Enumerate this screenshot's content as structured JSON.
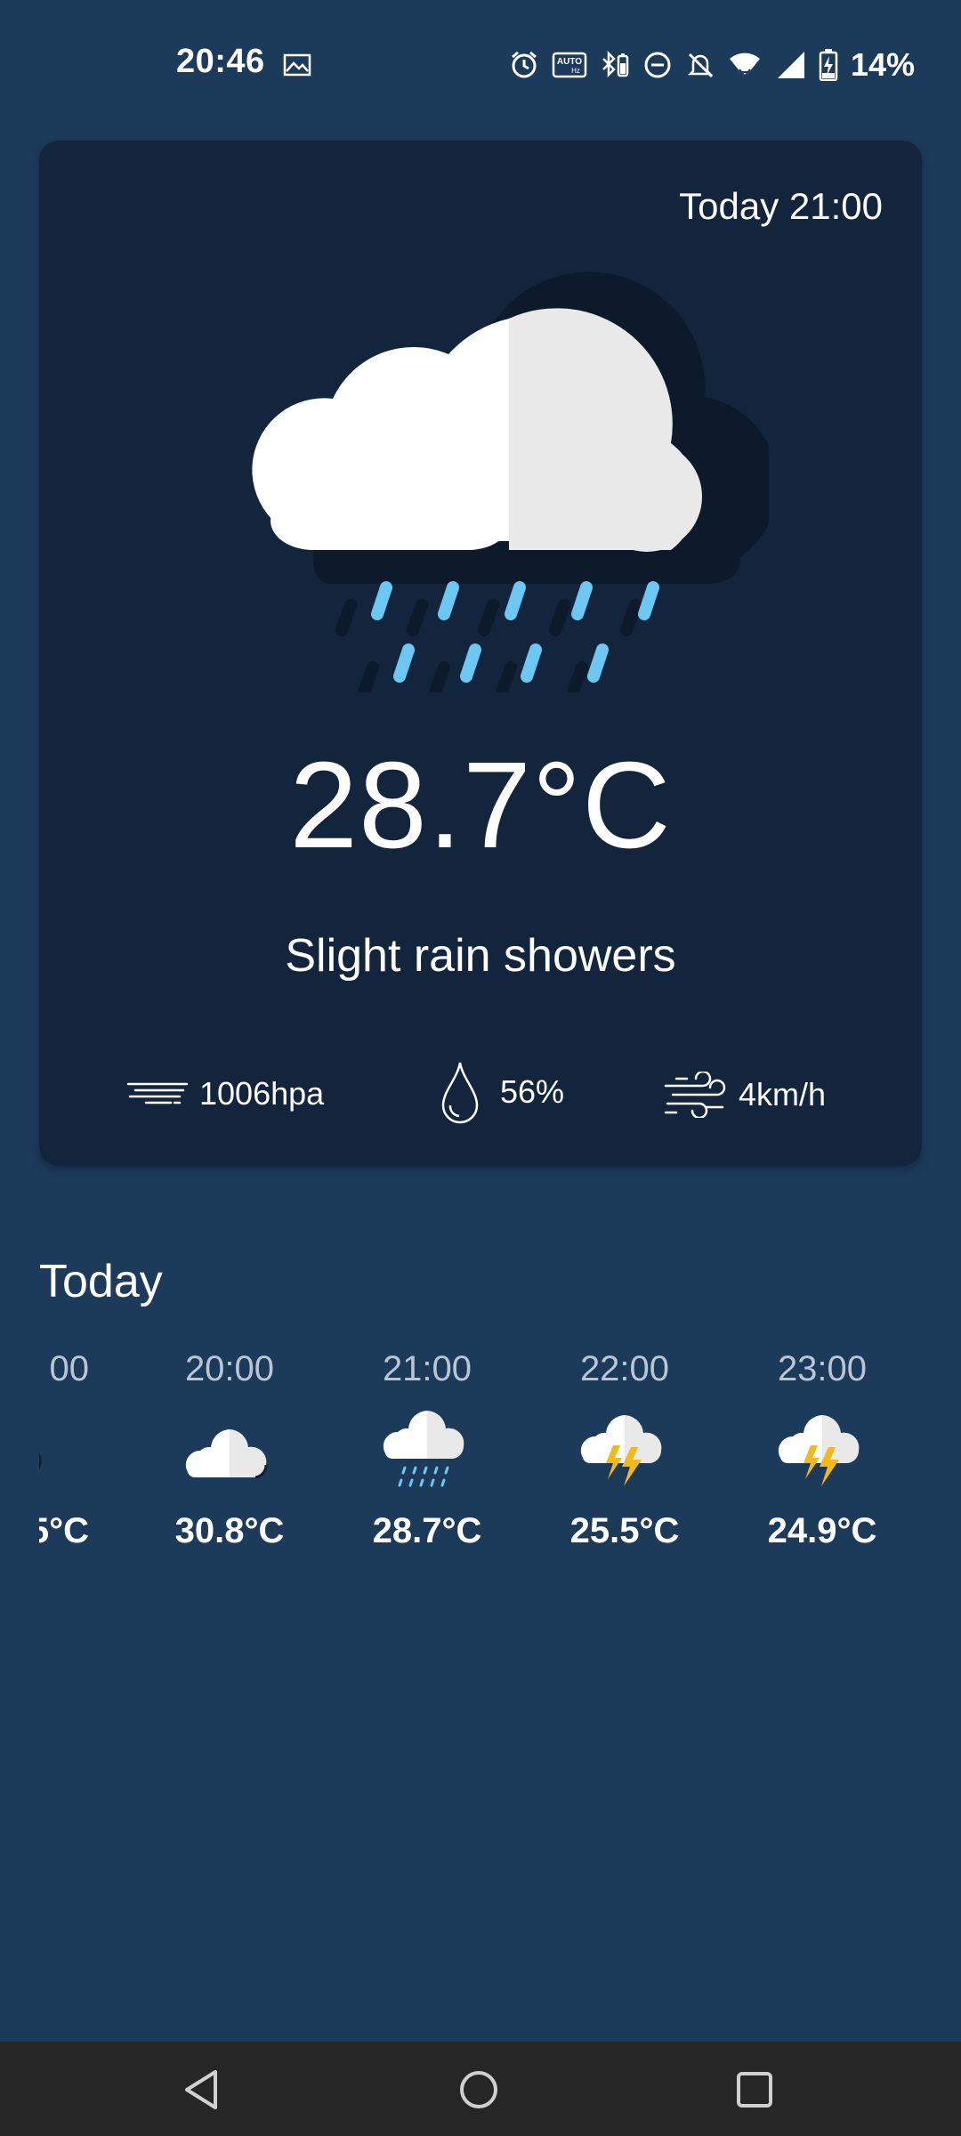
{
  "status_bar": {
    "time": "20:46",
    "battery": "14%",
    "icons": [
      "image-icon",
      "alarm-icon",
      "auto-hz-icon",
      "bluetooth-battery-icon",
      "do-not-disturb-icon",
      "bell-off-icon",
      "wifi-icon",
      "signal-icon",
      "battery-charging-icon"
    ]
  },
  "current": {
    "datetime": "Today 21:00",
    "temperature": "28.7°C",
    "description": "Slight rain showers",
    "icon": "cloud-rain-icon",
    "pressure": "1006hpa",
    "humidity": "56%",
    "wind": "4km/h"
  },
  "today": {
    "title": "Today",
    "hours": [
      {
        "time": "00",
        "temp": "5°C",
        "icon": "cloud-icon"
      },
      {
        "time": "20:00",
        "temp": "30.8°C",
        "icon": "cloud-icon"
      },
      {
        "time": "21:00",
        "temp": "28.7°C",
        "icon": "cloud-rain-icon"
      },
      {
        "time": "22:00",
        "temp": "25.5°C",
        "icon": "cloud-lightning-icon"
      },
      {
        "time": "23:00",
        "temp": "24.9°C",
        "icon": "cloud-lightning-icon"
      }
    ]
  },
  "navigation": {
    "buttons": [
      "back-icon",
      "home-icon",
      "recents-icon"
    ]
  },
  "colors": {
    "background": "#1c3a5a",
    "card": "#13253c",
    "rain": "#6cc8f2",
    "lightning": "#f2b81c",
    "cloud_light": "#ffffff",
    "cloud_shade": "#e8e8e8"
  }
}
